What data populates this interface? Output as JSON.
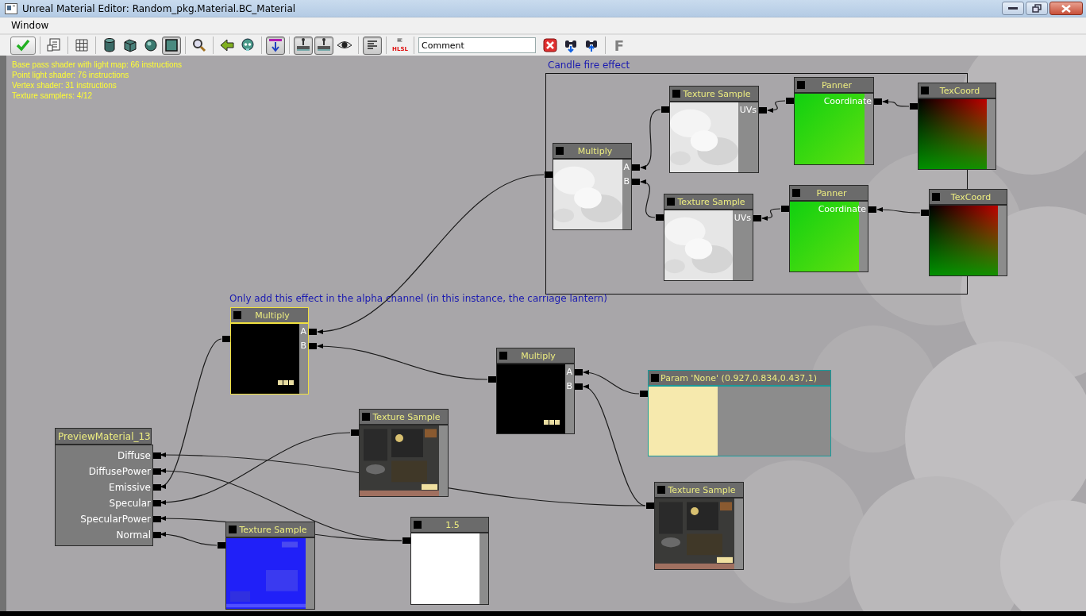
{
  "window": {
    "title": "Unreal Material Editor: Random_pkg.Material.BC_Material"
  },
  "menu": [
    "Window"
  ],
  "toolbar": [
    [
      {
        "kind": "button",
        "on": false,
        "disabled": false
      }
    ],
    [
      {
        "kind": "button",
        "on": false,
        "disabled": false
      }
    ],
    [
      {
        "kind": "button",
        "on": false,
        "disabled": false
      }
    ],
    [
      {
        "kind": "button",
        "on": false,
        "disabled": false
      },
      {
        "kind": "button",
        "on": false,
        "disabled": false
      },
      {
        "kind": "button",
        "on": false,
        "disabled": false
      },
      {
        "kind": "button",
        "on": true,
        "disabled": false
      }
    ],
    [
      {
        "kind": "button",
        "on": false,
        "disabled": false
      }
    ],
    [
      {
        "kind": "button",
        "on": false,
        "disabled": false
      },
      {
        "kind": "button",
        "on": false,
        "disabled": false
      }
    ],
    [
      {
        "kind": "button",
        "on": true,
        "disabled": false
      }
    ],
    [
      {
        "kind": "button",
        "on": true,
        "disabled": false
      },
      {
        "kind": "button",
        "on": true,
        "disabled": false
      },
      {
        "kind": "button",
        "on": false,
        "disabled": false
      }
    ],
    [
      {
        "kind": "button",
        "on": true,
        "disabled": false
      }
    ],
    [
      {
        "kind": "button",
        "on": false,
        "disabled": false,
        "label": "HLSL"
      }
    ],
    [
      {
        "kind": "field",
        "value": "Comment"
      },
      {
        "kind": "button",
        "on": false,
        "disabled": false
      },
      {
        "kind": "button",
        "on": false,
        "disabled": false
      },
      {
        "kind": "button",
        "on": false,
        "disabled": false
      }
    ],
    [
      {
        "kind": "button",
        "on": false,
        "disabled": true,
        "label": "F"
      }
    ]
  ],
  "stats": [
    "Base pass shader with light map: 66 instructions",
    "Point light shader: 76 instructions",
    "Vertex shader: 31 instructions",
    "Texture samplers: 4/12"
  ],
  "comments": [
    {
      "text": "Candle fire effect",
      "frame": true
    },
    {
      "text": "Only add this effect in the alpha channel (in this instance, the carriage lantern)",
      "frame": false
    }
  ],
  "nodes": [
    {
      "kind": "expression",
      "title": "Panner",
      "selected": false,
      "pins": [
        "Coordinate"
      ],
      "preview": {
        "kind": "green"
      }
    },
    {
      "kind": "expression",
      "title": "TexCoord",
      "selected": false,
      "preview": {
        "kind": "uv"
      }
    },
    {
      "kind": "expression",
      "title": "Texture Sample",
      "selected": false,
      "pins": [
        "UVs"
      ],
      "preview": {
        "kind": "cloud"
      }
    },
    {
      "kind": "expression",
      "title": "Multiply",
      "selected": false,
      "pins": [
        "A",
        "B"
      ],
      "preview": {
        "kind": "cloud"
      }
    },
    {
      "kind": "expression",
      "title": "Panner",
      "selected": false,
      "pins": [
        "Coordinate"
      ],
      "preview": {
        "kind": "green"
      }
    },
    {
      "kind": "expression",
      "title": "TexCoord",
      "selected": false,
      "preview": {
        "kind": "uv"
      }
    },
    {
      "kind": "expression",
      "title": "Texture Sample",
      "selected": false,
      "pins": [
        "UVs"
      ],
      "preview": {
        "kind": "cloud"
      }
    },
    {
      "kind": "expression",
      "title": "Multiply",
      "selected": true,
      "pins": [
        "A",
        "B"
      ],
      "preview": {
        "kind": "black"
      }
    },
    {
      "kind": "expression",
      "title": "Multiply",
      "selected": false,
      "pins": [
        "A",
        "B"
      ],
      "preview": {
        "kind": "black"
      }
    },
    {
      "kind": "parameter",
      "title": "Param 'None' (0.927,0.834,0.437,1)",
      "selected": false,
      "preview": {
        "kind": "swatch"
      }
    },
    {
      "kind": "expression",
      "title": "Texture Sample",
      "selected": false,
      "preview": {
        "kind": "map"
      }
    },
    {
      "kind": "material",
      "title": "PreviewMaterial_13",
      "selected": false,
      "pins": [
        "Diffuse",
        "DiffusePower",
        "Emissive",
        "Specular",
        "SpecularPower",
        "Normal"
      ]
    },
    {
      "kind": "expression",
      "title": "Texture Sample",
      "selected": false,
      "preview": {
        "kind": "map"
      }
    },
    {
      "kind": "expression",
      "title": "1.5",
      "selected": false,
      "preview": {
        "kind": "white"
      }
    },
    {
      "kind": "expression",
      "title": "Texture Sample",
      "selected": false,
      "preview": {
        "kind": "normal"
      }
    }
  ]
}
